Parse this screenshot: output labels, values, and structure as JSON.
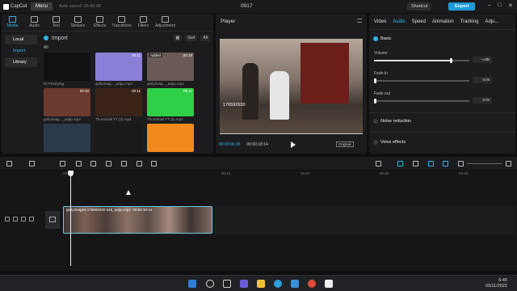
{
  "app": {
    "name": "CapCut",
    "menu_label": "Menu",
    "autosave": "Auto saved: 06:40:08",
    "project_title": "0917",
    "shortcut_label": "Shortcut",
    "export_label": "Export"
  },
  "toolbar": {
    "tabs": [
      "Media",
      "Audio",
      "Text",
      "Stickers",
      "Effects",
      "Transitions",
      "Filters",
      "Adjustment"
    ]
  },
  "side_nav": {
    "local": "Local",
    "import": "Import",
    "library": "Library"
  },
  "media": {
    "import_label": "Import",
    "sort_label": "Sort",
    "filter_label": "All",
    "section_label": "All",
    "items": [
      {
        "caption": "IG Feed.png",
        "duration": "",
        "color": "#111111",
        "added": ""
      },
      {
        "caption": "gettyimag..._adpp.mp4",
        "duration": "00:11",
        "color": "#8a7fd6",
        "added": ""
      },
      {
        "caption": "gettyimag..._adpp.mp4",
        "duration": "00:18",
        "color": "#6b5a58",
        "added": "Added"
      },
      {
        "caption": "gettyimag..._adpp.mp4",
        "duration": "00:30",
        "color": "#6a3a2e",
        "added": ""
      },
      {
        "caption": "Thumbnail YT (3).mp4",
        "duration": "00:11",
        "color": "#3a2418",
        "added": ""
      },
      {
        "caption": "Thumbnail YT (2).mp4",
        "duration": "00:11",
        "color": "#2fcf47",
        "added": ""
      },
      {
        "caption": "",
        "duration": "",
        "color": "#2a3a4a",
        "added": ""
      },
      {
        "caption": "",
        "duration": "",
        "color": "#1a1a1a",
        "added": ""
      },
      {
        "caption": "",
        "duration": "",
        "color": "#f08a1c",
        "added": ""
      }
    ]
  },
  "player": {
    "title": "Player",
    "overlay_id": "176592630",
    "time_current": "00:00:00:25",
    "time_total": "00:00:18:14",
    "original_label": "Original"
  },
  "inspector": {
    "tabs": [
      "Video",
      "Audio",
      "Speed",
      "Animation",
      "Tracking",
      "Adju..."
    ],
    "active_tab": "Audio",
    "basic_label": "Basic",
    "volume_label": "Volume",
    "volume_value": "-∞dB",
    "volume_level": 0.8,
    "fade_in_label": "Fade-in",
    "fade_in_value": "0.0s",
    "fade_in_level": 0.0,
    "fade_out_label": "Fade-out",
    "fade_out_value": "0.0s",
    "fade_out_level": 0.0,
    "noise_label": "Noise reduction",
    "voice_label": "Voice effects"
  },
  "timeline": {
    "ruler": [
      "00:00",
      "00:10",
      "00:20",
      "00:30",
      "00:40",
      "00:50"
    ],
    "clip_name": "gettyimages-176592630-640_adpp.mp4",
    "clip_duration": "00:00:18:14"
  },
  "taskbar": {
    "time": "6:40",
    "date": "03/11/2022"
  }
}
